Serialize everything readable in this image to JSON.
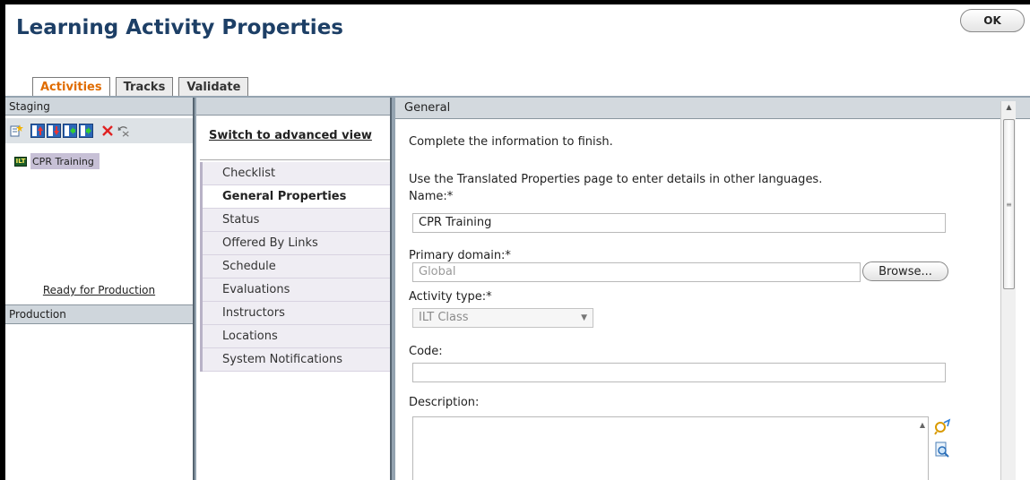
{
  "page_title": "Learning Activity Properties",
  "ok_label": "OK",
  "tabs": [
    {
      "label": "Activities",
      "active": true
    },
    {
      "label": "Tracks",
      "active": false
    },
    {
      "label": "Validate",
      "active": false
    }
  ],
  "staging": {
    "header": "Staging",
    "toolbar_icons": [
      "new-activity-icon",
      "move-up-icon",
      "move-down-icon",
      "move-left-icon",
      "move-right-icon",
      "delete-icon",
      "undo-icon"
    ],
    "tree_item_label": "CPR Training",
    "tree_item_badge": "ILT",
    "ready_link": "Ready for Production"
  },
  "production": {
    "header": "Production"
  },
  "nav": {
    "advanced_link": "Switch to advanced view",
    "items": [
      {
        "label": "Checklist",
        "active": false
      },
      {
        "label": "General Properties",
        "active": true
      },
      {
        "label": "Status",
        "active": false
      },
      {
        "label": "Offered By Links",
        "active": false
      },
      {
        "label": "Schedule",
        "active": false
      },
      {
        "label": "Evaluations",
        "active": false
      },
      {
        "label": "Instructors",
        "active": false
      },
      {
        "label": "Locations",
        "active": false
      },
      {
        "label": "System Notifications",
        "active": false
      }
    ]
  },
  "general": {
    "header": "General",
    "intro": "Complete the information to finish.",
    "translated_note": "Use the Translated Properties page to enter details in other languages.",
    "name_label": "Name:*",
    "name_value": "CPR Training",
    "domain_label": "Primary domain:*",
    "domain_value": "Global",
    "browse_label": "Browse...",
    "activity_type_label": "Activity type:*",
    "activity_type_value": "ILT Class",
    "code_label": "Code:",
    "code_value": "",
    "description_label": "Description:"
  },
  "colors": {
    "accent_tab": "#e06c00",
    "title": "#1d3f66",
    "nav_bg": "#efedf3"
  }
}
